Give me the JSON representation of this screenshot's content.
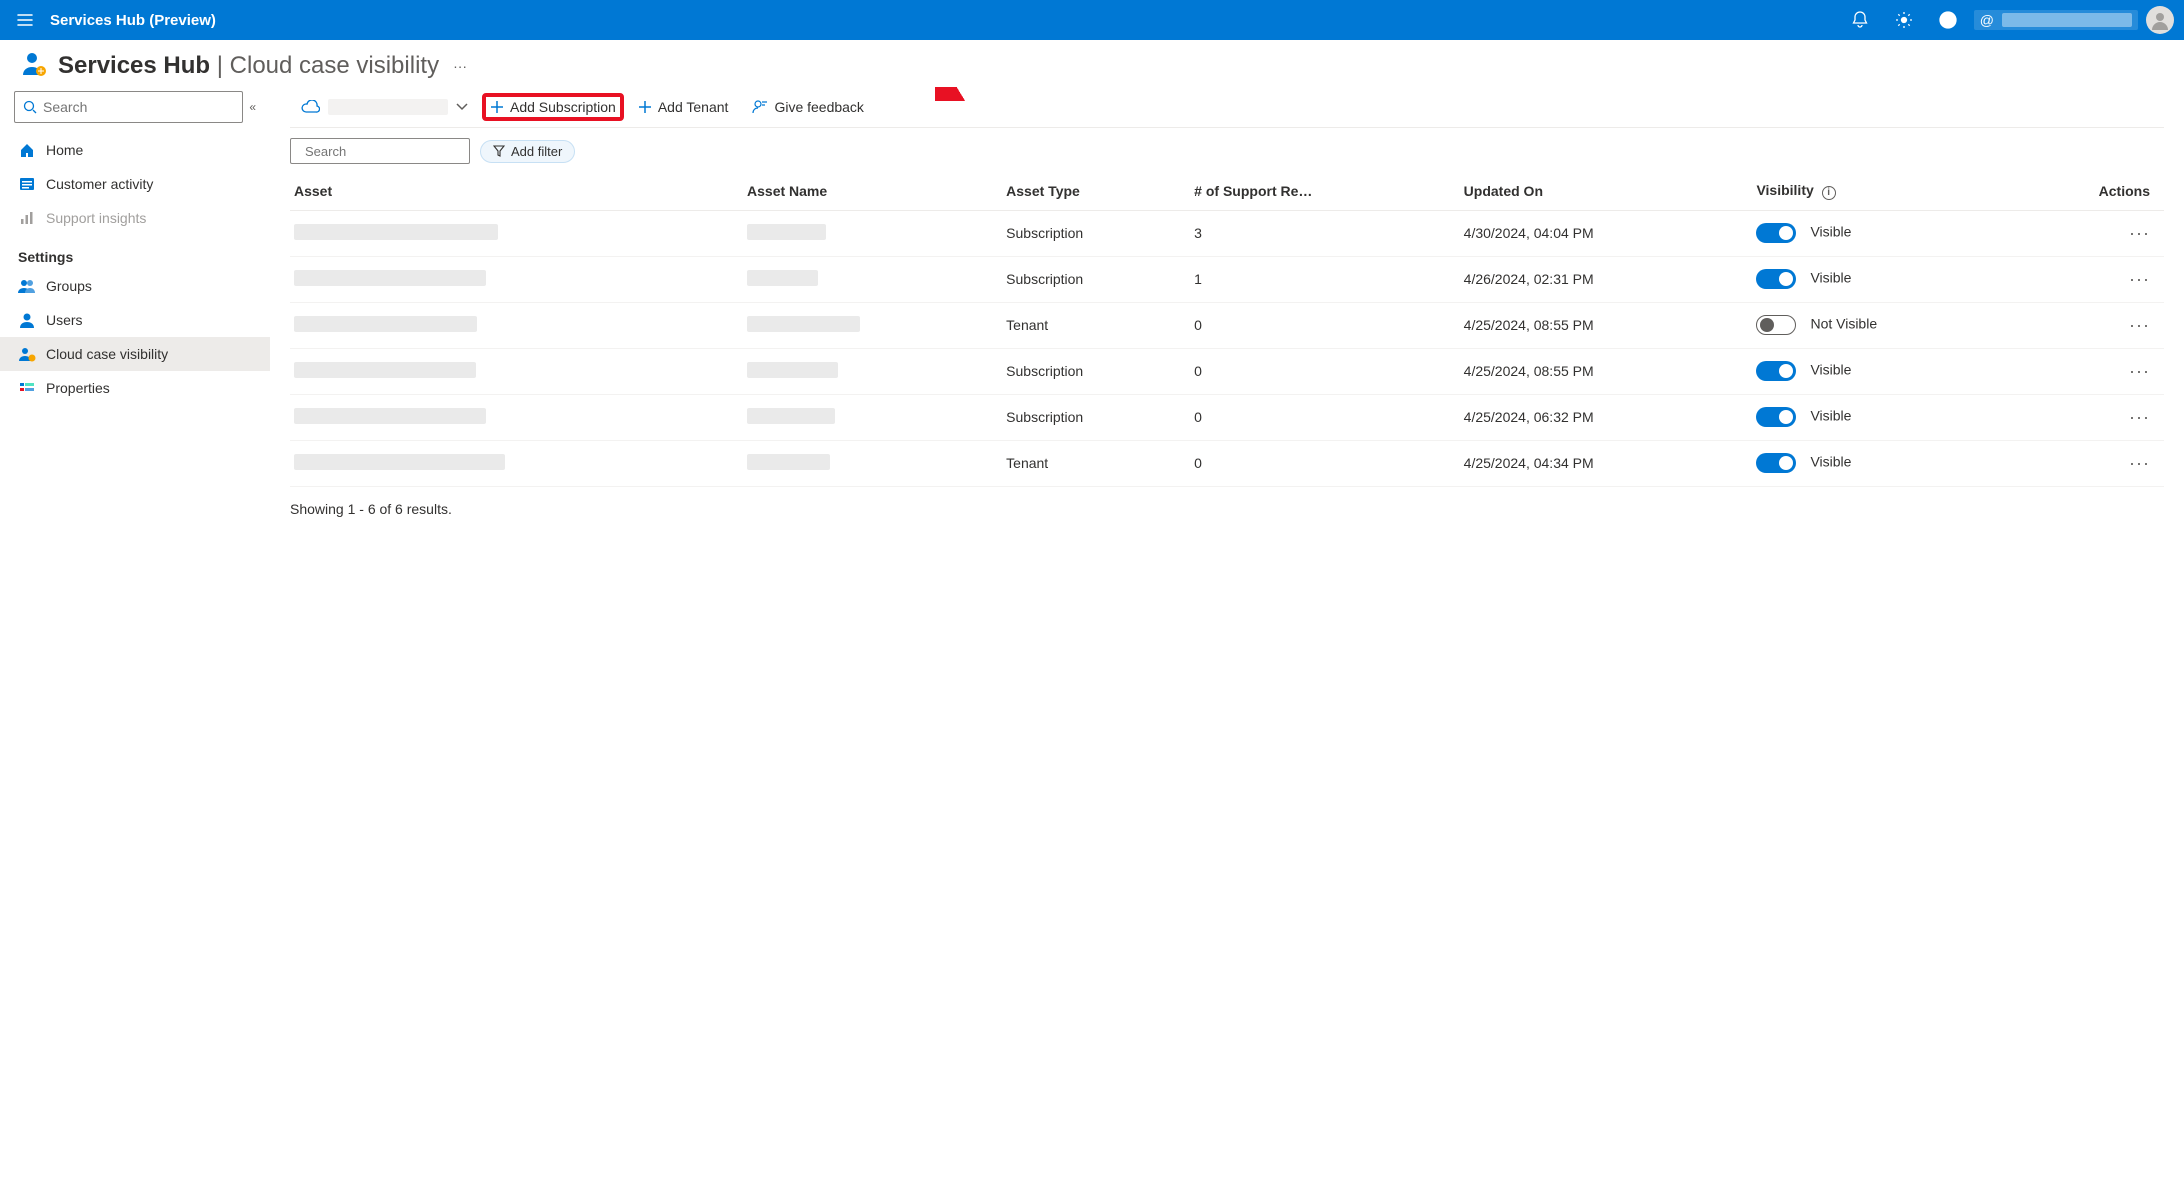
{
  "topbar": {
    "title": "Services Hub (Preview)",
    "user_email_prefix": "@"
  },
  "header": {
    "service": "Services Hub",
    "page": "Cloud case visibility"
  },
  "sidebar": {
    "search_placeholder": "Search",
    "items": [
      {
        "key": "home",
        "label": "Home",
        "icon": "home",
        "active": false,
        "disabled": false
      },
      {
        "key": "customer-activity",
        "label": "Customer activity",
        "icon": "list",
        "active": false,
        "disabled": false
      },
      {
        "key": "support-insights",
        "label": "Support insights",
        "icon": "chart",
        "active": false,
        "disabled": true
      }
    ],
    "section_label": "Settings",
    "settings_items": [
      {
        "key": "groups",
        "label": "Groups",
        "icon": "group",
        "active": false
      },
      {
        "key": "users",
        "label": "Users",
        "icon": "user",
        "active": false
      },
      {
        "key": "cloud-case",
        "label": "Cloud case visibility",
        "icon": "cloud-person",
        "active": true
      },
      {
        "key": "properties",
        "label": "Properties",
        "icon": "props",
        "active": false
      }
    ]
  },
  "cmdbar": {
    "add_subscription": "Add Subscription",
    "add_tenant": "Add Tenant",
    "give_feedback": "Give feedback"
  },
  "filterbar": {
    "search_placeholder": "Search",
    "add_filter": "Add filter"
  },
  "table": {
    "columns": [
      "Asset",
      "Asset Name",
      "Asset Type",
      "# of Support Re…",
      "Updated On",
      "Visibility",
      "Actions"
    ],
    "rows": [
      {
        "asset_type": "Subscription",
        "support_req": "3",
        "updated": "4/30/2024, 04:04 PM",
        "visible": true,
        "visibility_label": "Visible"
      },
      {
        "asset_type": "Subscription",
        "support_req": "1",
        "updated": "4/26/2024, 02:31 PM",
        "visible": true,
        "visibility_label": "Visible"
      },
      {
        "asset_type": "Tenant",
        "support_req": "0",
        "updated": "4/25/2024, 08:55 PM",
        "visible": false,
        "visibility_label": "Not Visible"
      },
      {
        "asset_type": "Subscription",
        "support_req": "0",
        "updated": "4/25/2024, 08:55 PM",
        "visible": true,
        "visibility_label": "Visible"
      },
      {
        "asset_type": "Subscription",
        "support_req": "0",
        "updated": "4/25/2024, 06:32 PM",
        "visible": true,
        "visibility_label": "Visible"
      },
      {
        "asset_type": "Tenant",
        "support_req": "0",
        "updated": "4/25/2024, 04:34 PM",
        "visible": true,
        "visibility_label": "Visible"
      }
    ],
    "footer": "Showing 1 - 6 of 6 results."
  }
}
